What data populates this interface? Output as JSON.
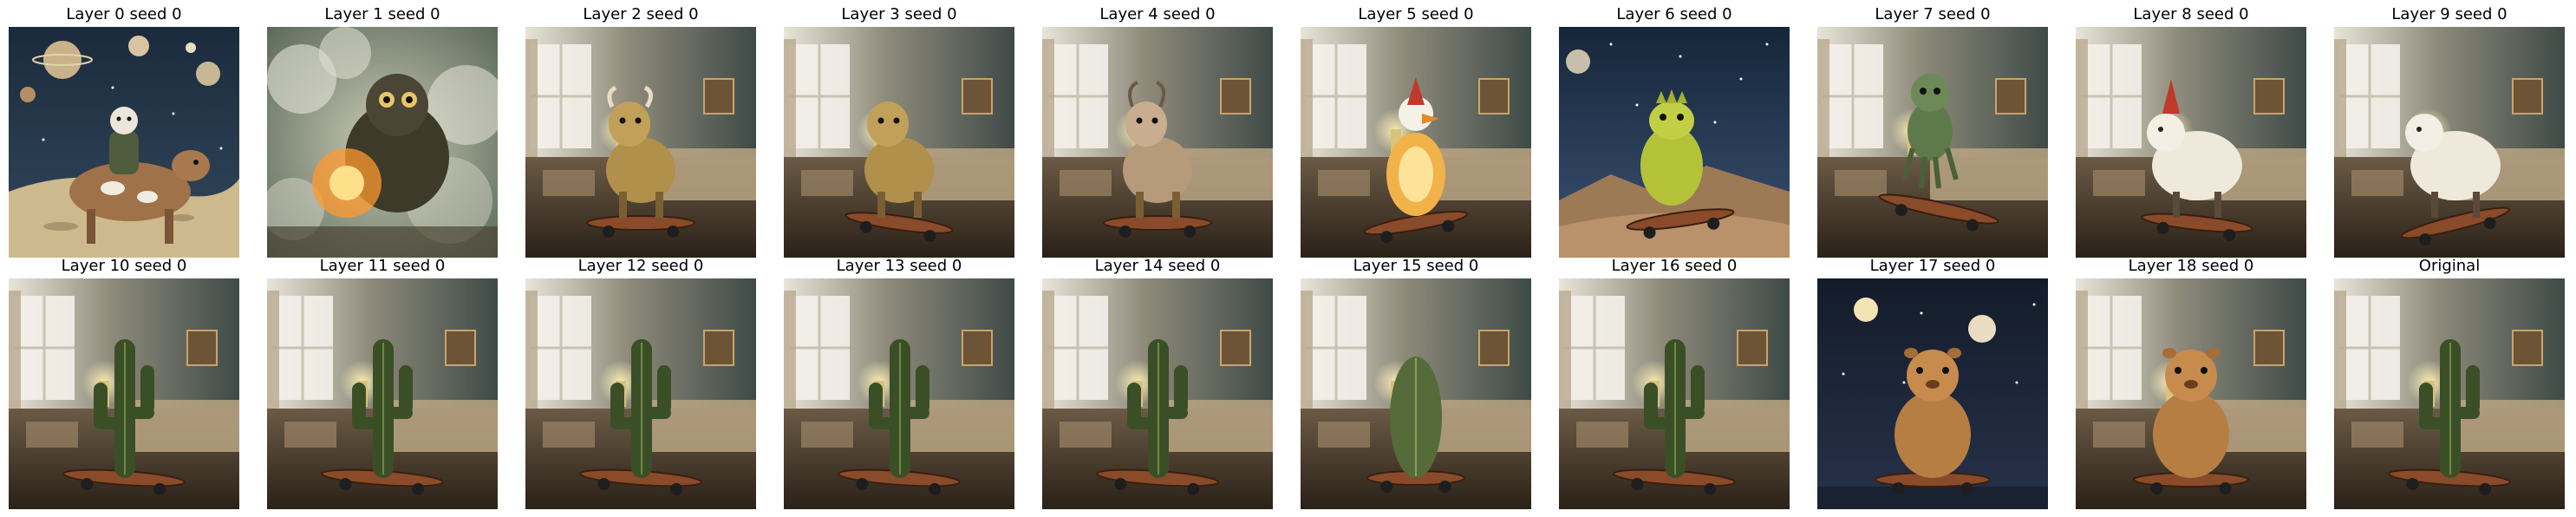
{
  "grid": {
    "panels": [
      {
        "title": "Layer 0 seed 0",
        "scene": "space",
        "subject": "cow-rider"
      },
      {
        "title": "Layer 1 seed 0",
        "scene": "smoke",
        "subject": "creature-glow"
      },
      {
        "title": "Layer 2 seed 0",
        "scene": "bedroom",
        "subject": "bull"
      },
      {
        "title": "Layer 3 seed 0",
        "scene": "bedroom",
        "subject": "dog"
      },
      {
        "title": "Layer 4 seed 0",
        "scene": "bedroom",
        "subject": "goat"
      },
      {
        "title": "Layer 5 seed 0",
        "scene": "bedroom",
        "subject": "duck-glow"
      },
      {
        "title": "Layer 6 seed 0",
        "scene": "desert",
        "subject": "lizard"
      },
      {
        "title": "Layer 7 seed 0",
        "scene": "bedroom",
        "subject": "alien"
      },
      {
        "title": "Layer 8 seed 0",
        "scene": "bedroom",
        "subject": "sheep"
      },
      {
        "title": "Layer 9 seed 0",
        "scene": "bedroom",
        "subject": "sheep-board"
      },
      {
        "title": "Layer 10 seed 0",
        "scene": "bedroom",
        "subject": "cactus"
      },
      {
        "title": "Layer 11 seed 0",
        "scene": "bedroom",
        "subject": "cactus"
      },
      {
        "title": "Layer 12 seed 0",
        "scene": "bedroom",
        "subject": "cactus"
      },
      {
        "title": "Layer 13 seed 0",
        "scene": "bedroom",
        "subject": "cactus"
      },
      {
        "title": "Layer 14 seed 0",
        "scene": "bedroom",
        "subject": "cactus"
      },
      {
        "title": "Layer 15 seed 0",
        "scene": "bedroom",
        "subject": "cactus-fat"
      },
      {
        "title": "Layer 16 seed 0",
        "scene": "bedroom",
        "subject": "cactus"
      },
      {
        "title": "Layer 17 seed 0",
        "scene": "night",
        "subject": "hamster"
      },
      {
        "title": "Layer 18 seed 0",
        "scene": "bedroom",
        "subject": "hamster"
      },
      {
        "title": "Original",
        "scene": "bedroom",
        "subject": "cactus"
      }
    ]
  }
}
